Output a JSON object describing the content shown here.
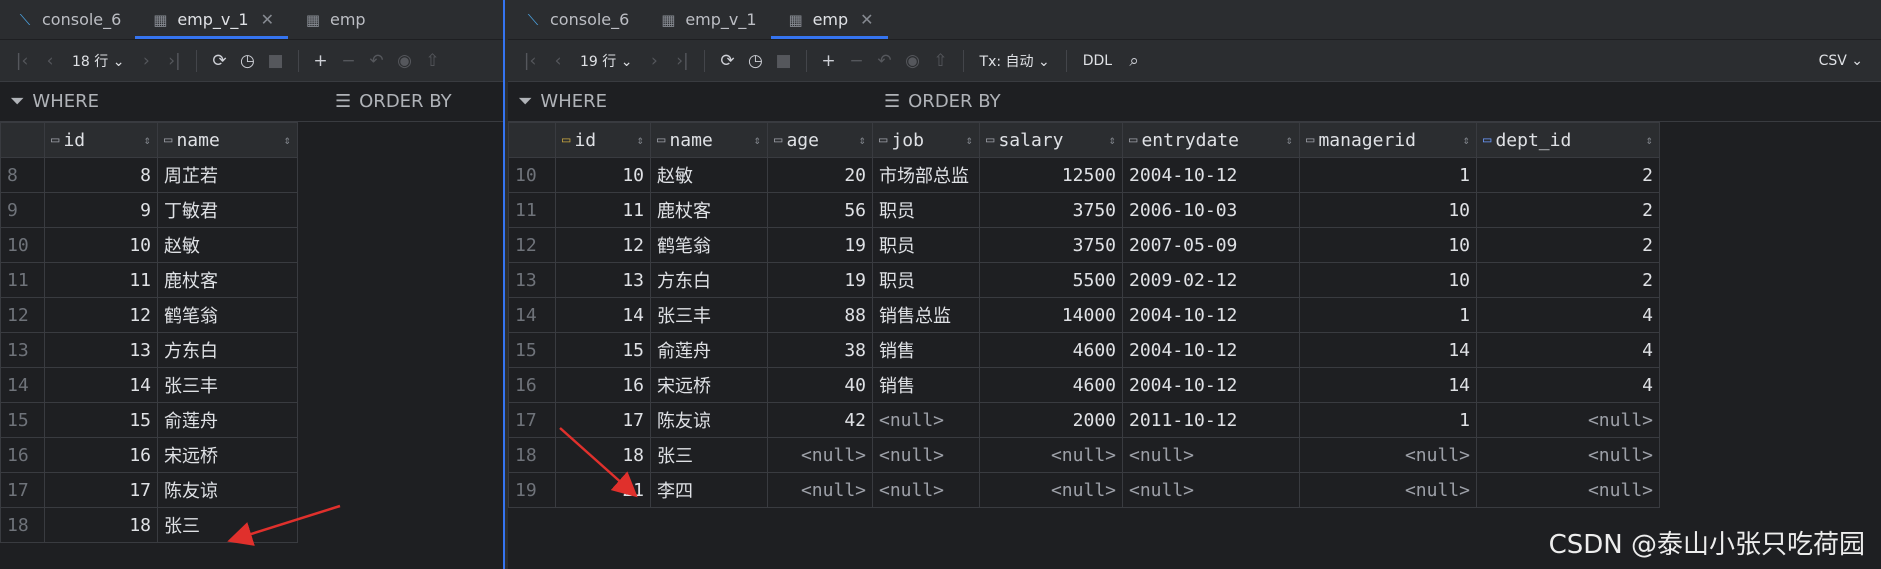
{
  "left": {
    "tabs": [
      {
        "label": "console_6",
        "icon": "console-icon"
      },
      {
        "label": "emp_v_1",
        "icon": "table-icon",
        "active": true
      },
      {
        "label": "emp",
        "icon": "table-icon"
      }
    ],
    "toolbar": {
      "rows_label": "18 行"
    },
    "filter": {
      "where": "WHERE",
      "order_by": "ORDER BY"
    },
    "columns": [
      "id",
      "name"
    ],
    "rows": [
      {
        "n": "8",
        "id": "8",
        "name": "周芷若"
      },
      {
        "n": "9",
        "id": "9",
        "name": "丁敏君"
      },
      {
        "n": "10",
        "id": "10",
        "name": "赵敏"
      },
      {
        "n": "11",
        "id": "11",
        "name": "鹿杖客"
      },
      {
        "n": "12",
        "id": "12",
        "name": "鹤笔翁"
      },
      {
        "n": "13",
        "id": "13",
        "name": "方东白"
      },
      {
        "n": "14",
        "id": "14",
        "name": "张三丰"
      },
      {
        "n": "15",
        "id": "15",
        "name": "俞莲舟"
      },
      {
        "n": "16",
        "id": "16",
        "name": "宋远桥"
      },
      {
        "n": "17",
        "id": "17",
        "name": "陈友谅"
      },
      {
        "n": "18",
        "id": "18",
        "name": "张三"
      }
    ]
  },
  "right": {
    "tabs": [
      {
        "label": "console_6",
        "icon": "console-icon"
      },
      {
        "label": "emp_v_1",
        "icon": "table-icon"
      },
      {
        "label": "emp",
        "icon": "table-icon",
        "active": true
      }
    ],
    "toolbar": {
      "rows_label": "19 行",
      "tx_label": "Tx: 自动",
      "ddl_label": "DDL",
      "csv_label": "CSV"
    },
    "filter": {
      "where": "WHERE",
      "order_by": "ORDER BY"
    },
    "columns": [
      "id",
      "name",
      "age",
      "job",
      "salary",
      "entrydate",
      "managerid",
      "dept_id"
    ],
    "rows": [
      {
        "n": "10",
        "id": "10",
        "name": "赵敏",
        "age": "20",
        "job": "市场部总监",
        "salary": "12500",
        "entrydate": "2004-10-12",
        "managerid": "1",
        "dept_id": "2"
      },
      {
        "n": "11",
        "id": "11",
        "name": "鹿杖客",
        "age": "56",
        "job": "职员",
        "salary": "3750",
        "entrydate": "2006-10-03",
        "managerid": "10",
        "dept_id": "2"
      },
      {
        "n": "12",
        "id": "12",
        "name": "鹤笔翁",
        "age": "19",
        "job": "职员",
        "salary": "3750",
        "entrydate": "2007-05-09",
        "managerid": "10",
        "dept_id": "2"
      },
      {
        "n": "13",
        "id": "13",
        "name": "方东白",
        "age": "19",
        "job": "职员",
        "salary": "5500",
        "entrydate": "2009-02-12",
        "managerid": "10",
        "dept_id": "2"
      },
      {
        "n": "14",
        "id": "14",
        "name": "张三丰",
        "age": "88",
        "job": "销售总监",
        "salary": "14000",
        "entrydate": "2004-10-12",
        "managerid": "1",
        "dept_id": "4"
      },
      {
        "n": "15",
        "id": "15",
        "name": "俞莲舟",
        "age": "38",
        "job": "销售",
        "salary": "4600",
        "entrydate": "2004-10-12",
        "managerid": "14",
        "dept_id": "4"
      },
      {
        "n": "16",
        "id": "16",
        "name": "宋远桥",
        "age": "40",
        "job": "销售",
        "salary": "4600",
        "entrydate": "2004-10-12",
        "managerid": "14",
        "dept_id": "4"
      },
      {
        "n": "17",
        "id": "17",
        "name": "陈友谅",
        "age": "42",
        "job": "<null>",
        "salary": "2000",
        "entrydate": "2011-10-12",
        "managerid": "1",
        "dept_id": "<null>"
      },
      {
        "n": "18",
        "id": "18",
        "name": "张三",
        "age": "<null>",
        "job": "<null>",
        "salary": "<null>",
        "entrydate": "<null>",
        "managerid": "<null>",
        "dept_id": "<null>"
      },
      {
        "n": "19",
        "id": "21",
        "name": "李四",
        "age": "<null>",
        "job": "<null>",
        "salary": "<null>",
        "entrydate": "<null>",
        "managerid": "<null>",
        "dept_id": "<null>"
      }
    ]
  },
  "watermark": "CSDN @泰山小张只吃荷园",
  "accent_color": "#3574f0",
  "arrow_color": "#e0302c"
}
